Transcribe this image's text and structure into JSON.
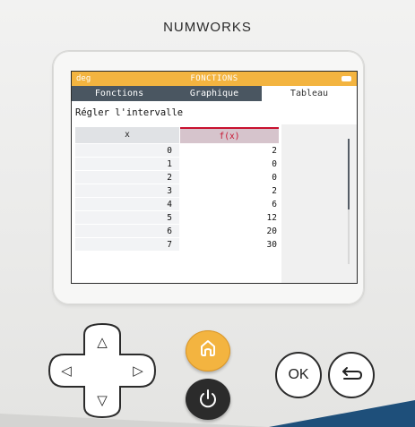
{
  "device": {
    "brand": "NUMWORKS"
  },
  "status_bar": {
    "mode": "deg",
    "title": "FONCTIONS",
    "battery": "battery-icon"
  },
  "tabs": [
    {
      "label": "Fonctions",
      "active": false
    },
    {
      "label": "Graphique",
      "active": false
    },
    {
      "label": "Tableau",
      "active": true
    }
  ],
  "intervalle_label": "Régler l'intervalle",
  "table": {
    "headers": {
      "x": "x",
      "fx": "f(x)"
    },
    "rows": [
      {
        "x": "0",
        "fx": "2"
      },
      {
        "x": "1",
        "fx": "0"
      },
      {
        "x": "2",
        "fx": "0"
      },
      {
        "x": "3",
        "fx": "2"
      },
      {
        "x": "4",
        "fx": "6"
      },
      {
        "x": "5",
        "fx": "12"
      },
      {
        "x": "6",
        "fx": "20"
      },
      {
        "x": "7",
        "fx": "30"
      }
    ]
  },
  "buttons": {
    "ok_label": "OK",
    "home_icon": "home-icon",
    "power_icon": "power-icon",
    "back_icon": "back-arrow-icon",
    "dpad_icons": [
      "up-arrow-icon",
      "left-arrow-icon",
      "right-arrow-icon",
      "down-arrow-icon"
    ]
  },
  "colors": {
    "status_bar": "#f3b440",
    "tab_bar": "#4a5661",
    "fx_header_accent": "#c8102e",
    "home_button": "#f3b440",
    "power_button": "#2b2b2b"
  }
}
